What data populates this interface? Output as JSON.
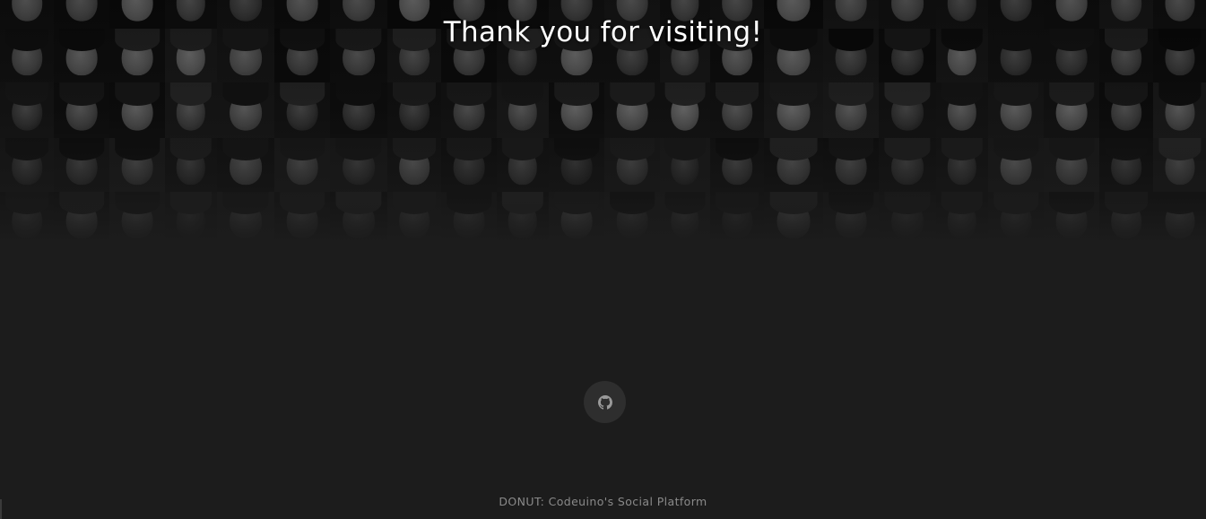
{
  "hero": {
    "title": "Thank you for visiting!",
    "background_image": "portrait-collage"
  },
  "social": {
    "github_icon": "github-icon"
  },
  "footer": {
    "text": "DONUT: Codeuino's Social Platform"
  },
  "colors": {
    "page_background": "#1c1c1c",
    "title_text": "#ffffff",
    "footer_text": "#8a8a8a",
    "icon_button_background": "#2e2e2e",
    "icon_color": "#9a9a9a"
  }
}
